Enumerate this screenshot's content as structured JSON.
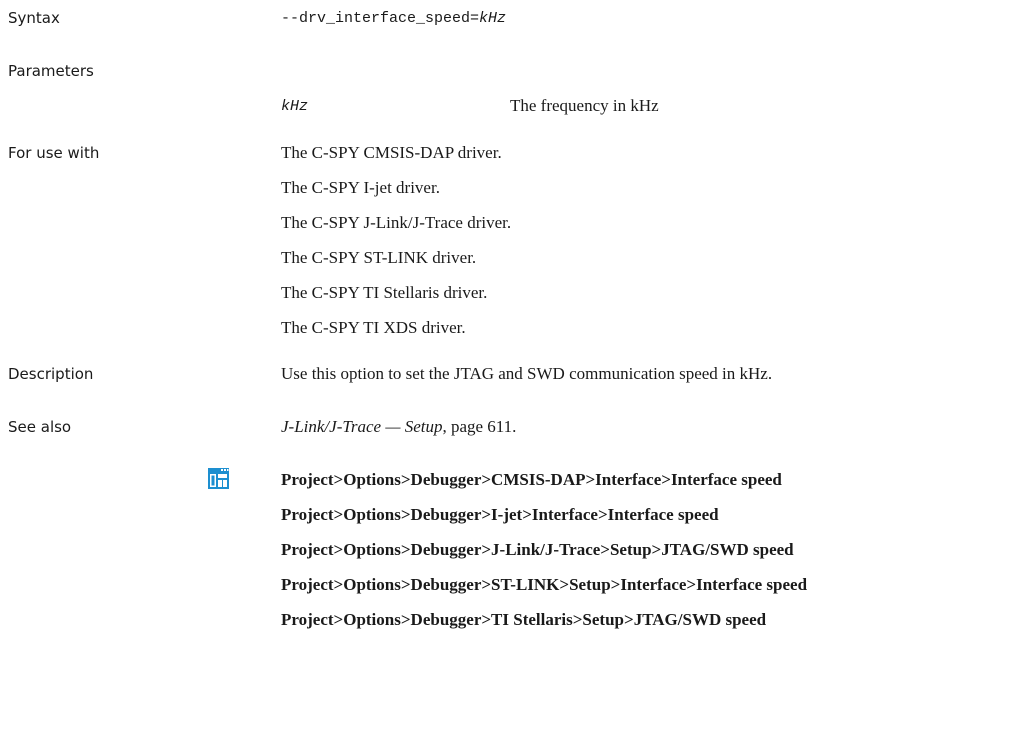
{
  "syntax": {
    "label": "Syntax",
    "option": "--drv_interface_speed=",
    "arg": "kHz"
  },
  "parameters": {
    "label": "Parameters",
    "name": "kHz",
    "desc": "The frequency in kHz"
  },
  "for_use_with": {
    "label": "For use with",
    "items": [
      "The C-SPY CMSIS-DAP driver.",
      "The C-SPY I-jet driver.",
      "The C-SPY J-Link/J-Trace driver.",
      "The C-SPY ST-LINK driver.",
      "The C-SPY TI Stellaris driver.",
      "The C-SPY TI XDS driver."
    ]
  },
  "description": {
    "label": "Description",
    "text": "Use this option to set the JTAG and SWD communication speed in kHz."
  },
  "see_also": {
    "label": "See also",
    "link": "J-Link/J-Trace — Setup",
    "page_ref": ", page 611."
  },
  "ide_paths": [
    "Project>Options>Debugger>CMSIS-DAP>Interface>Interface speed",
    "Project>Options>Debugger>I-jet>Interface>Interface speed",
    "Project>Options>Debugger>J-Link/J-Trace>Setup>JTAG/SWD speed",
    "Project>Options>Debugger>ST-LINK>Setup>Interface>Interface speed",
    "Project>Options>Debugger>TI Stellaris>Setup>JTAG/SWD speed"
  ],
  "icon": "ide-options-icon",
  "colors": {
    "icon_blue": "#1d8fd0"
  }
}
